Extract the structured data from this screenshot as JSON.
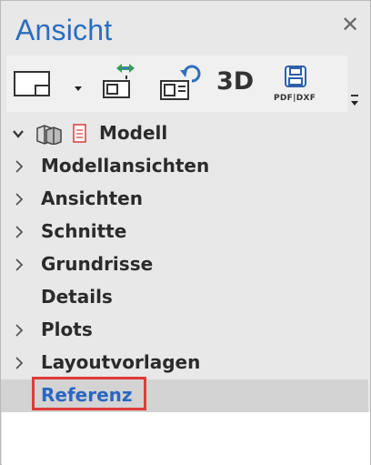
{
  "panel": {
    "title": "Ansicht",
    "close_icon": "close-icon"
  },
  "toolbar": {
    "buttons": [
      {
        "icon": "view-frame-icon"
      },
      {
        "icon": "dropdown-arrow-icon"
      },
      {
        "icon": "swap-view-icon"
      },
      {
        "icon": "refresh-view-icon"
      },
      {
        "label": "3D"
      },
      {
        "label": "PDF|DXF",
        "icon": "save-disk-icon"
      }
    ]
  },
  "tree": {
    "root": {
      "label": "Modell",
      "icons": [
        "model-boxes-icon",
        "document-icon"
      ]
    },
    "items": [
      {
        "label": "Modellansichten",
        "expandable": true
      },
      {
        "label": "Ansichten",
        "expandable": true
      },
      {
        "label": "Schnitte",
        "expandable": true
      },
      {
        "label": "Grundrisse",
        "expandable": true
      },
      {
        "label": "Details",
        "expandable": false
      },
      {
        "label": "Plots",
        "expandable": true
      },
      {
        "label": "Layoutvorlagen",
        "expandable": true
      },
      {
        "label": "Referenz",
        "expandable": false,
        "selected": true
      }
    ]
  },
  "colors": {
    "accent": "#2a6ebf",
    "highlight": "#e03a3a"
  }
}
